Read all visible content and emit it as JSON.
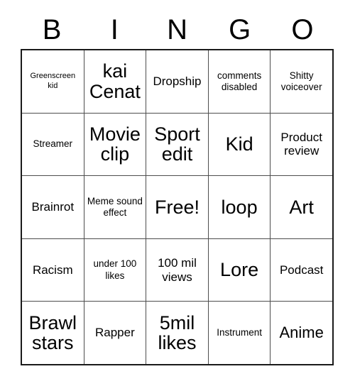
{
  "card": {
    "header_letters": [
      "B",
      "I",
      "N",
      "G",
      "O"
    ],
    "background_color": "#ffffff",
    "grid_border_color": "#1a1a1a",
    "grid_line_color": "#4d4d4d",
    "text_color": "#000000",
    "rows": 5,
    "columns": 5,
    "cells": [
      [
        {
          "text": "Greenscreen kid",
          "size": "xs",
          "free_space": false
        },
        {
          "text": "kai Cenat",
          "size": "xl",
          "free_space": false
        },
        {
          "text": "Dropship",
          "size": "m",
          "free_space": false
        },
        {
          "text": "comments disabled",
          "size": "s",
          "free_space": false
        },
        {
          "text": "Shitty voiceover",
          "size": "s",
          "free_space": false
        }
      ],
      [
        {
          "text": "Streamer",
          "size": "s",
          "free_space": false
        },
        {
          "text": "Movie clip",
          "size": "xl",
          "free_space": false
        },
        {
          "text": "Sport edit",
          "size": "xl",
          "free_space": false
        },
        {
          "text": "Kid",
          "size": "xl",
          "free_space": false
        },
        {
          "text": "Product review",
          "size": "m",
          "free_space": false
        }
      ],
      [
        {
          "text": "Brainrot",
          "size": "m",
          "free_space": false
        },
        {
          "text": "Meme sound effect",
          "size": "s",
          "free_space": false
        },
        {
          "text": "Free!",
          "size": "xl",
          "free_space": true
        },
        {
          "text": "loop",
          "size": "xl",
          "free_space": false
        },
        {
          "text": "Art",
          "size": "xl",
          "free_space": false
        }
      ],
      [
        {
          "text": "Racism",
          "size": "m",
          "free_space": false
        },
        {
          "text": "under 100 likes",
          "size": "s",
          "free_space": false
        },
        {
          "text": "100 mil views",
          "size": "m",
          "free_space": false
        },
        {
          "text": "Lore",
          "size": "xl",
          "free_space": false
        },
        {
          "text": "Podcast",
          "size": "m",
          "free_space": false
        }
      ],
      [
        {
          "text": "Brawl stars",
          "size": "xl",
          "free_space": false
        },
        {
          "text": "Rapper",
          "size": "m",
          "free_space": false
        },
        {
          "text": "5mil likes",
          "size": "xl",
          "free_space": false
        },
        {
          "text": "Instrument",
          "size": "s",
          "free_space": false
        },
        {
          "text": "Anime",
          "size": "l",
          "free_space": false
        }
      ]
    ]
  }
}
